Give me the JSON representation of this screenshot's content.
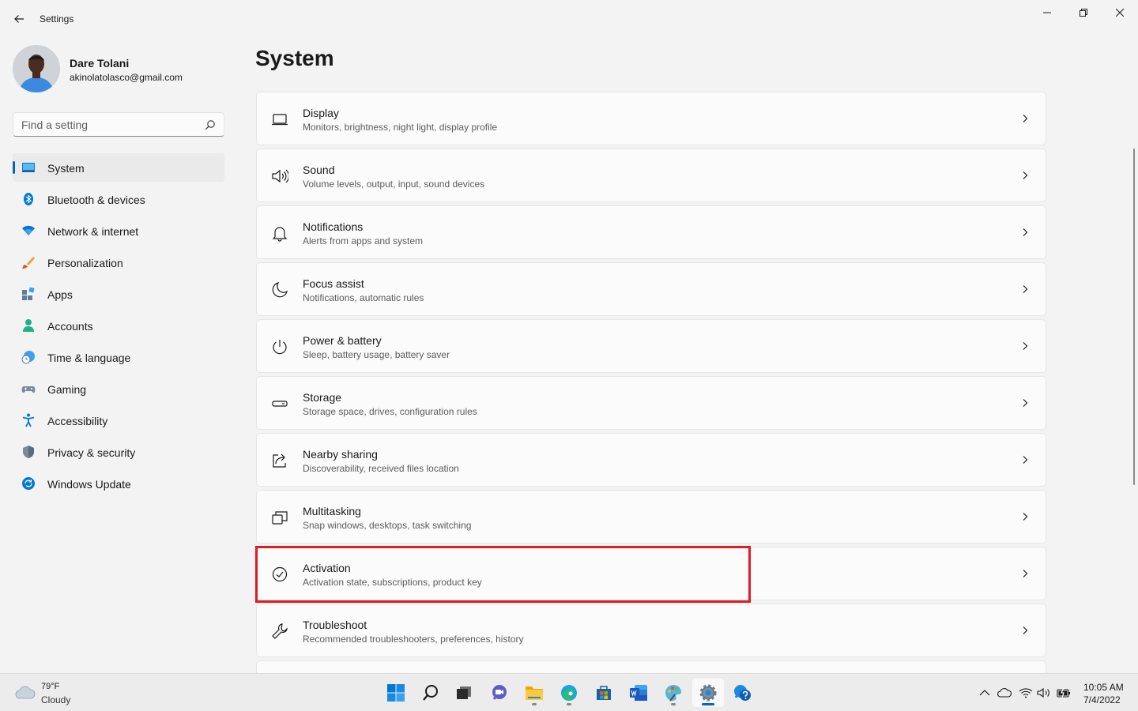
{
  "window": {
    "title": "Settings"
  },
  "profile": {
    "name": "Dare Tolani",
    "email": "akinolatolasco@gmail.com"
  },
  "search": {
    "placeholder": "Find a setting"
  },
  "sidebar": {
    "items": [
      {
        "label": "System",
        "icon": "system-icon",
        "selected": true
      },
      {
        "label": "Bluetooth & devices",
        "icon": "bluetooth-icon"
      },
      {
        "label": "Network & internet",
        "icon": "wifi-icon"
      },
      {
        "label": "Personalization",
        "icon": "brush-icon"
      },
      {
        "label": "Apps",
        "icon": "apps-icon"
      },
      {
        "label": "Accounts",
        "icon": "person-icon"
      },
      {
        "label": "Time & language",
        "icon": "globe-clock-icon"
      },
      {
        "label": "Gaming",
        "icon": "gamepad-icon"
      },
      {
        "label": "Accessibility",
        "icon": "accessibility-icon"
      },
      {
        "label": "Privacy & security",
        "icon": "shield-icon"
      },
      {
        "label": "Windows Update",
        "icon": "update-icon"
      }
    ]
  },
  "page": {
    "title": "System"
  },
  "settings": [
    {
      "title": "Display",
      "subtitle": "Monitors, brightness, night light, display profile",
      "icon": "monitor-icon"
    },
    {
      "title": "Sound",
      "subtitle": "Volume levels, output, input, sound devices",
      "icon": "speaker-icon"
    },
    {
      "title": "Notifications",
      "subtitle": "Alerts from apps and system",
      "icon": "bell-icon"
    },
    {
      "title": "Focus assist",
      "subtitle": "Notifications, automatic rules",
      "icon": "moon-icon"
    },
    {
      "title": "Power & battery",
      "subtitle": "Sleep, battery usage, battery saver",
      "icon": "power-icon"
    },
    {
      "title": "Storage",
      "subtitle": "Storage space, drives, configuration rules",
      "icon": "drive-icon"
    },
    {
      "title": "Nearby sharing",
      "subtitle": "Discoverability, received files location",
      "icon": "share-icon"
    },
    {
      "title": "Multitasking",
      "subtitle": "Snap windows, desktops, task switching",
      "icon": "windows-stack-icon"
    },
    {
      "title": "Activation",
      "subtitle": "Activation state, subscriptions, product key",
      "icon": "check-circle-icon"
    },
    {
      "title": "Troubleshoot",
      "subtitle": "Recommended troubleshooters, preferences, history",
      "icon": "wrench-icon"
    },
    {
      "title": "",
      "subtitle": "",
      "icon": ""
    }
  ],
  "taskbar": {
    "weather": {
      "temp": "79°F",
      "condition": "Cloudy"
    },
    "clock": {
      "time": "10:05 AM",
      "date": "7/4/2022"
    }
  },
  "colors": {
    "accent": "#0067c0",
    "highlight": "#e01b24"
  }
}
